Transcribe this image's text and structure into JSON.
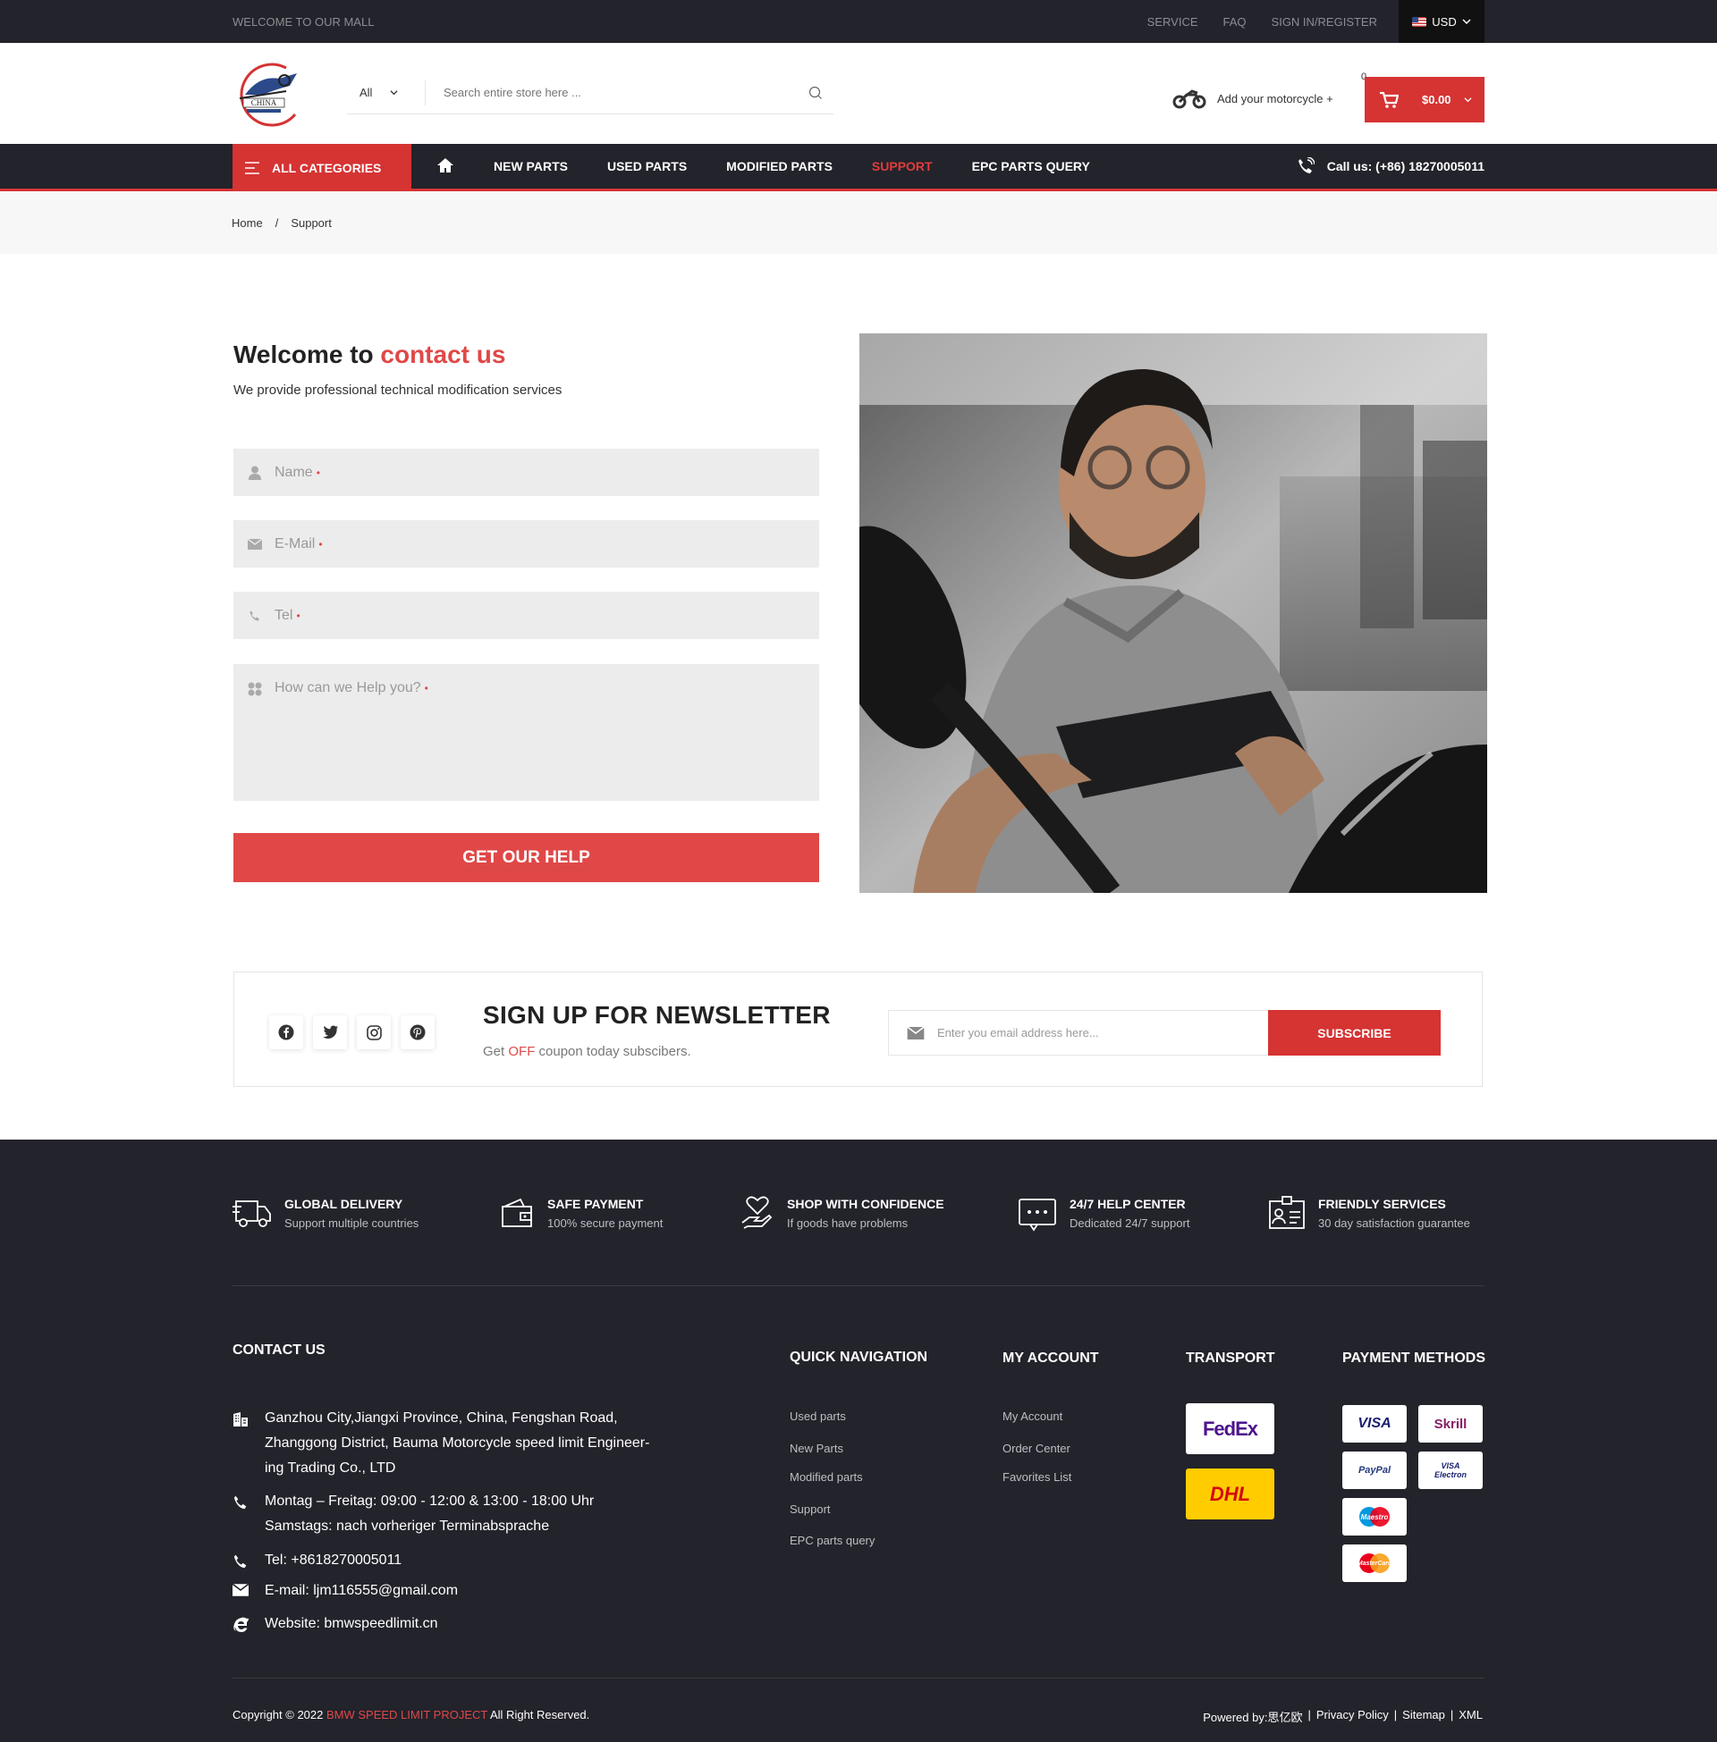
{
  "topbar": {
    "welcome": "WELCOME TO OUR MALL",
    "links": [
      "SERVICE",
      "FAQ",
      "SIGN IN/REGISTER"
    ],
    "currency": "USD"
  },
  "header": {
    "logo_text": "CHINA",
    "search": {
      "category": "All",
      "placeholder": "Search entire store here ..."
    },
    "add_motorcycle": "Add your motorcycle +",
    "cart": {
      "count": "0",
      "total": "$0.00"
    }
  },
  "nav": {
    "all_categories": "ALL CATEGORIES",
    "items": [
      "NEW PARTS",
      "USED PARTS",
      "MODIFIED PARTS",
      "SUPPORT",
      "EPC PARTS QUERY"
    ],
    "active": "SUPPORT",
    "call_us": "Call us: (+86) 18270005011"
  },
  "breadcrumb": {
    "home": "Home",
    "separator": "/",
    "current": "Support"
  },
  "contact": {
    "title_prefix": "Welcome to",
    "title_highlight": "contact us",
    "subtitle": "We provide professional technical modification services",
    "fields": {
      "name": "Name",
      "email": "E-Mail",
      "tel": "Tel",
      "message": "How can we Help you?"
    },
    "required_mark": "•",
    "submit": "GET OUR HELP"
  },
  "newsletter": {
    "title": "SIGN UP FOR NEWSLETTER",
    "sub_prefix": "Get",
    "sub_highlight": "OFF",
    "sub_suffix": "coupon today subscibers.",
    "placeholder": "Enter you email address here...",
    "button": "SUBSCRIBE",
    "social": [
      "facebook-icon",
      "twitter-icon",
      "instagram-icon",
      "pinterest-icon"
    ]
  },
  "features": [
    {
      "icon": "delivery-truck-icon",
      "title": "GLOBAL DELIVERY",
      "desc": "Support multiple countries"
    },
    {
      "icon": "wallet-icon",
      "title": "SAFE PAYMENT",
      "desc": "100% secure payment"
    },
    {
      "icon": "heart-hand-icon",
      "title": "SHOP WITH CONFIDENCE",
      "desc": "If goods have problems"
    },
    {
      "icon": "chat-support-icon",
      "title": "24/7 HELP CENTER",
      "desc": "Dedicated 24/7 support"
    },
    {
      "icon": "id-card-icon",
      "title": "FRIENDLY SERVICES",
      "desc": "30 day satisfaction guarantee"
    }
  ],
  "footer": {
    "contact_title": "CONTACT US",
    "address": [
      "Ganzhou City,Jiangxi Province, China, Fengshan Road,",
      "Zhanggong District, Bauma Motorcycle speed limit Engineer-",
      "ing Trading Co., LTD"
    ],
    "hours": [
      "Montag – Freitag: 09:00 - 12:00 & 13:00 - 18:00 Uhr",
      "Samstags: nach vorheriger Terminabsprache"
    ],
    "tel": "Tel: +8618270005011",
    "email": "E-mail: ljm116555@gmail.com",
    "website": "Website: bmwspeedlimit.cn",
    "quick_nav_title": "QUICK NAVIGATION",
    "quick_nav": [
      "Used parts",
      "New Parts",
      "Modified parts",
      "Support",
      "EPC parts query"
    ],
    "account_title": "MY ACCOUNT",
    "account": [
      "My Account",
      "Order Center",
      "Favorites List"
    ],
    "transport_title": "TRANSPORT",
    "transport": [
      "FedEx",
      "DHL"
    ],
    "payment_title": "PAYMENT METHODS",
    "payments": [
      "VISA",
      "Skrill",
      "PayPal",
      "VISA Electron",
      "Maestro",
      "MasterCard"
    ],
    "copyright_prefix": "Copyright © 2022",
    "copyright_brand": "BMW SPEED LIMIT PROJECT",
    "copyright_suffix": "All Right Reserved.",
    "powered": "Powered by:思亿欧",
    "bottom_links": [
      "Privacy Policy",
      "Sitemap",
      "XML"
    ]
  },
  "colors": {
    "accent": "#d63333",
    "dark": "#23232b",
    "field_bg": "#ececec"
  }
}
